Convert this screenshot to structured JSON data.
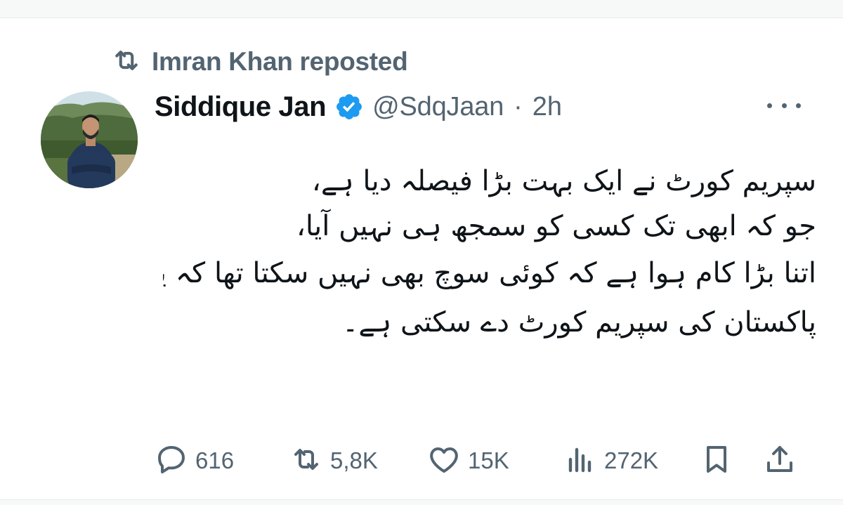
{
  "repost": {
    "icon": "repost-icon",
    "text": "Imran Khan reposted"
  },
  "author": {
    "name": "Siddique Jan",
    "verified_icon": "verified-badge-icon",
    "verified_color": "#1d9bf0",
    "handle": "@SdqJaan",
    "separator": "·",
    "time": "2h"
  },
  "tweet": {
    "lines": [
      "سپریم کورٹ نے ایک بہت بڑا فیصلہ دیا ہے،",
      "جو کہ ابھی تک کسی کو سمجھ ہی نہیں آیا،",
      "اتنا بڑا کام ہوا ہے کہ کوئی سوچ بھی نہیں سکتا تھا کہ یہ فیصلہ کبھی",
      "پاکستان کی سپریم کورٹ دے سکتی ہے۔"
    ]
  },
  "actions": {
    "replies": "616",
    "reposts": "5,8K",
    "likes": "15K",
    "views": "272K"
  },
  "colors": {
    "text": "#0f1419",
    "secondary": "#536471",
    "accent": "#1d9bf0"
  }
}
